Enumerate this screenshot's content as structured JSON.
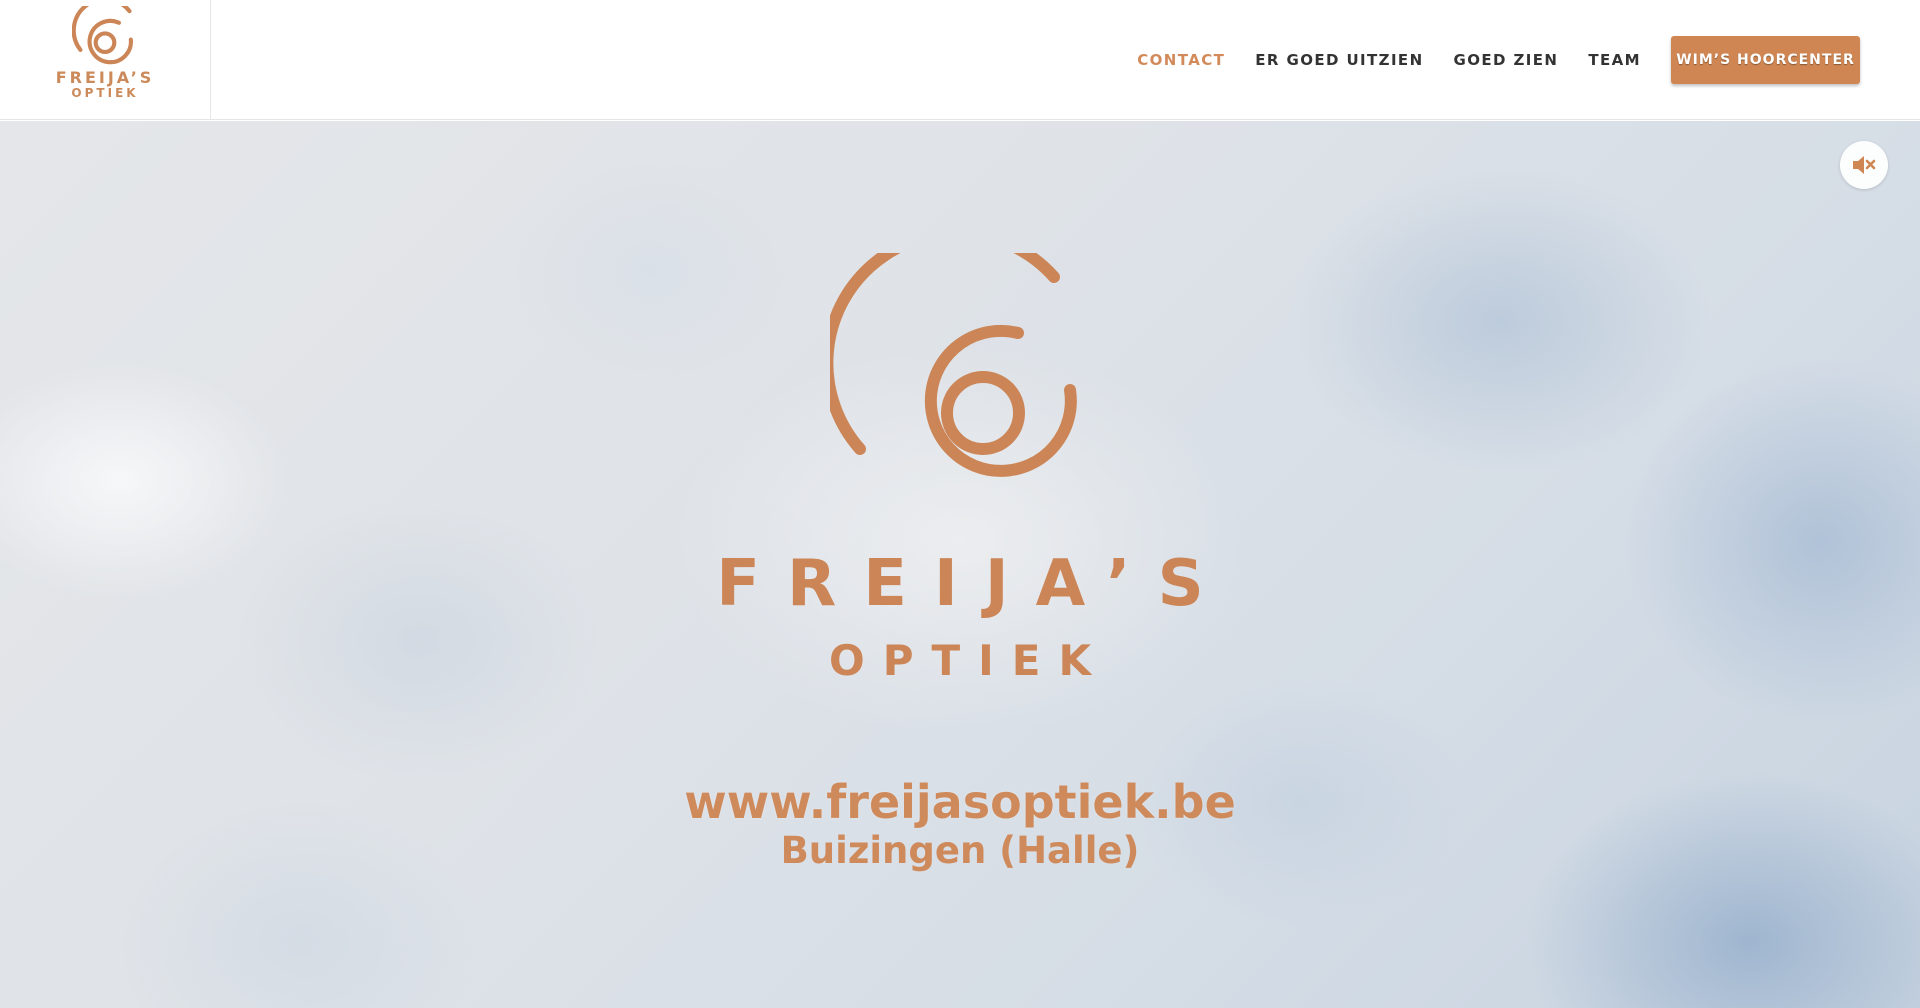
{
  "brand": {
    "name": "FREIJA’S",
    "sub": "OPTIEK",
    "color": "#cc8556"
  },
  "nav": {
    "items": [
      {
        "label": "CONTACT",
        "active": true
      },
      {
        "label": "ER GOED UITZIEN",
        "active": false
      },
      {
        "label": "GOED ZIEN",
        "active": false
      },
      {
        "label": "TEAM",
        "active": false
      }
    ],
    "cta_label": "WIM’S HOORCENTER",
    "active_color": "#d28a5a",
    "cta_color": "#cf8652"
  },
  "hero": {
    "name": "FREIJA’S",
    "sub": "OPTIEK",
    "url": "www.freijasoptiek.be",
    "location": "Buizingen (Halle)"
  },
  "controls": {
    "mute_icon": "speaker-muted-icon"
  }
}
